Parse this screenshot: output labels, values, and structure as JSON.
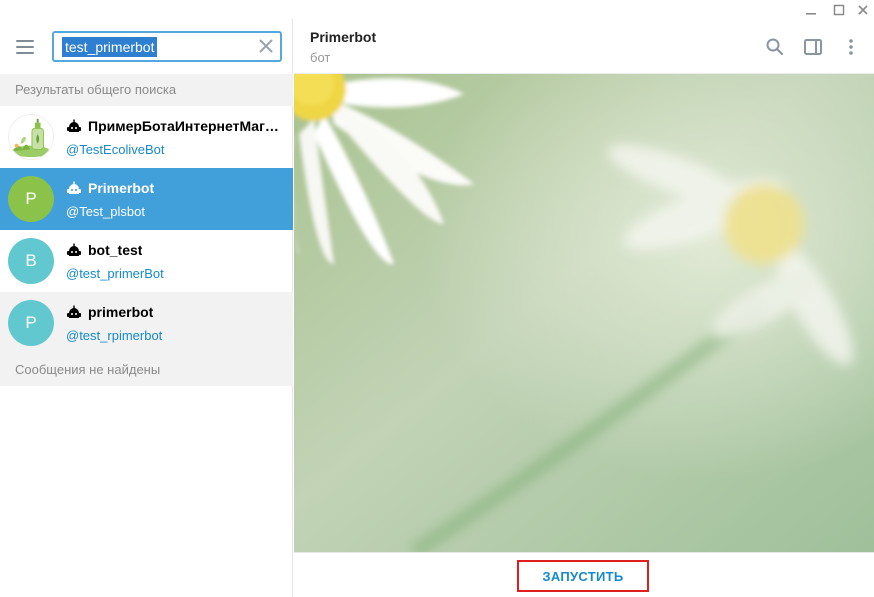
{
  "search": {
    "query": "test_primerbot",
    "global_results_label": "Результаты общего поиска",
    "no_messages_label": "Сообщения не найдены"
  },
  "results": [
    {
      "title": "ПримерБотаИнтернетМагазина",
      "username": "@TestEcoliveBot",
      "avatar_letter": "",
      "avatar_color": "#ffffff",
      "state": "normal"
    },
    {
      "title": "Primerbot",
      "username": "@Test_plsbot",
      "avatar_letter": "P",
      "avatar_color": "#8bc34a",
      "state": "selected"
    },
    {
      "title": "bot_test",
      "username": "@test_primerBot",
      "avatar_letter": "B",
      "avatar_color": "#62c8cf",
      "state": "normal"
    },
    {
      "title": "primerbot",
      "username": "@test_rpimerbot",
      "avatar_letter": "P",
      "avatar_color": "#62c8cf",
      "state": "hover"
    }
  ],
  "chat": {
    "title": "Primerbot",
    "status": "бот",
    "start_button": "ЗАПУСТИТЬ"
  },
  "colors": {
    "accent": "#419fd9",
    "link": "#168acd",
    "highlight_border": "#e11e1e"
  },
  "icons": [
    "menu-icon",
    "clear-icon",
    "bot-icon",
    "search-icon",
    "sidebar-toggle-icon",
    "more-icon",
    "minimize-icon",
    "maximize-icon",
    "close-icon"
  ]
}
